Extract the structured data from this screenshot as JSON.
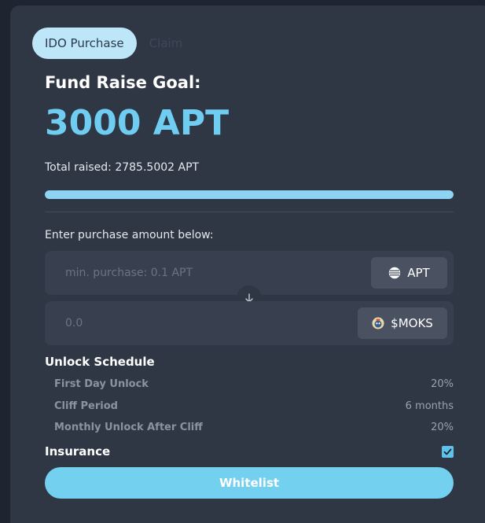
{
  "tabs": [
    {
      "label": "IDO Purchase",
      "active": true
    },
    {
      "label": "Claim",
      "active": false
    }
  ],
  "fund": {
    "goal_label": "Fund Raise Goal:",
    "goal_value": "3000 APT",
    "total_raised_label": "Total raised: 2785.5002 APT",
    "progress_fraction": 1.0
  },
  "purchase": {
    "prompt": "Enter purchase amount below:",
    "input_placeholder": "min. purchase: 0.1 APT",
    "output_placeholder": "0.0",
    "pay_token": "APT",
    "receive_token": "$MOKS",
    "pay_icon": "aptos-logo-icon",
    "receive_icon": "moks-token-icon",
    "swap_icon": "arrow-down-icon"
  },
  "schedule": {
    "title": "Unlock Schedule",
    "rows": [
      {
        "label": "First Day Unlock",
        "value": "20%"
      },
      {
        "label": "Cliff Period",
        "value": "6 months"
      },
      {
        "label": "Monthly Unlock After Cliff",
        "value": "20%"
      }
    ]
  },
  "insurance": {
    "label": "Insurance",
    "checked": true
  },
  "action": {
    "label": "Whitelist"
  },
  "colors": {
    "accent": "#6ecdf0",
    "background": "#2f3644",
    "input": "#384050"
  }
}
